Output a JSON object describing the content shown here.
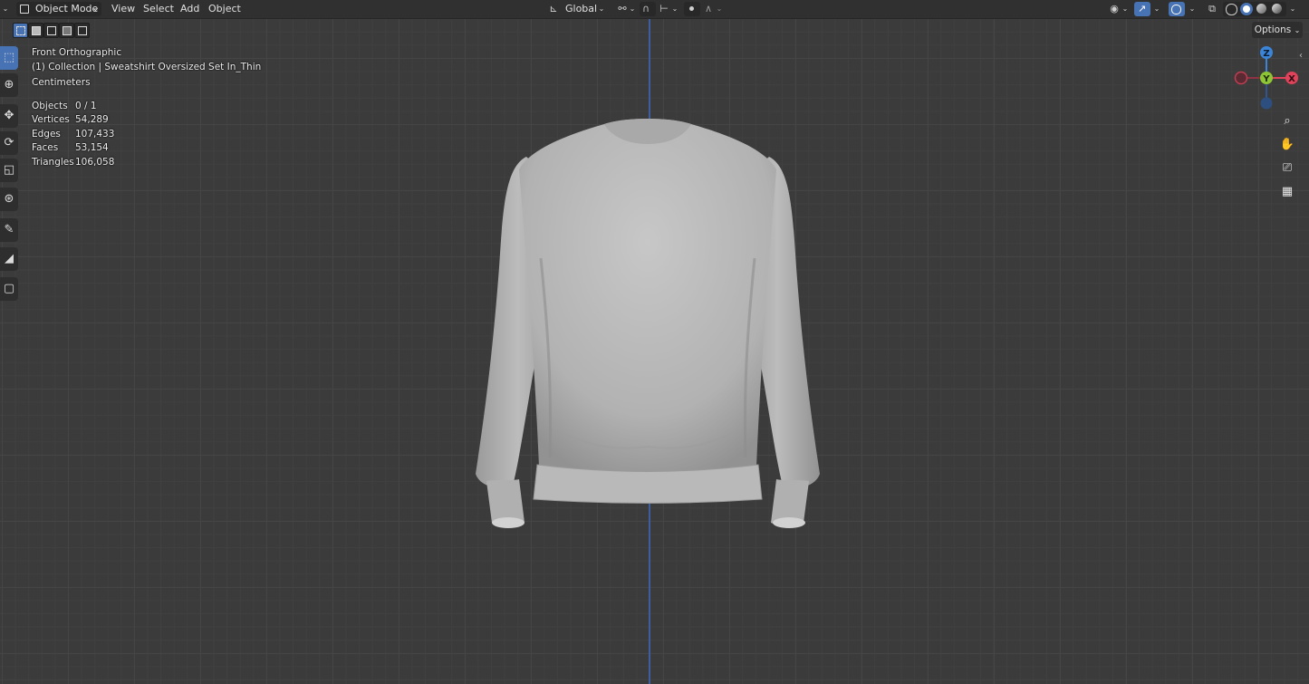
{
  "header": {
    "mode_label": "Object Mode",
    "menu": [
      "View",
      "Select",
      "Add",
      "Object"
    ],
    "transform_orientation": "Global"
  },
  "viewport": {
    "view_name": "Front Orthographic",
    "collection_label": "(1) Collection | Sweatshirt Oversized Set In_Thin",
    "units": "Centimeters",
    "options_label": "Options",
    "stats": [
      {
        "label": "Objects",
        "value": "0 / 1"
      },
      {
        "label": "Vertices",
        "value": "54,289"
      },
      {
        "label": "Edges",
        "value": "107,433"
      },
      {
        "label": "Faces",
        "value": "53,154"
      },
      {
        "label": "Triangles",
        "value": "106,058"
      }
    ]
  },
  "gizmo": {
    "axes": {
      "z": "Z",
      "y": "Y",
      "x": "X"
    },
    "colors": {
      "x": "#e0425a",
      "y": "#8ec534",
      "z": "#3b85d9"
    }
  },
  "icons": {
    "toolbar": [
      "select-box-icon",
      "cursor-icon",
      "move-icon",
      "rotate-icon",
      "scale-icon",
      "transform-icon",
      "annotate-icon",
      "measure-icon",
      "add-cube-icon"
    ],
    "navigation": [
      "zoom-icon",
      "pan-hand-icon",
      "camera-icon",
      "grid-icon"
    ]
  },
  "colors": {
    "accent": "#4772b3",
    "viewport_bg": "#3b3b3b",
    "header_bg": "#303030"
  }
}
